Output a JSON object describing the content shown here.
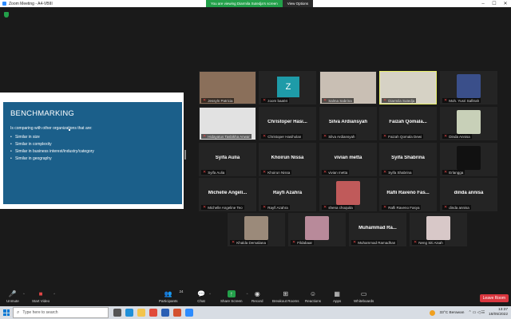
{
  "titlebar": {
    "title": "Zoom Meeting - A4-VBIII"
  },
  "banner": {
    "viewing": "You are viewing Diarmila Sutedja's screen",
    "options": "View Options"
  },
  "slide": {
    "title": "BENCHMARKING",
    "intro": "Is comparing with other organizations that are:",
    "bullets": [
      "Similar in size",
      "Similar in complexity",
      "Similar in business interest/industry/category",
      "Similar in geography"
    ]
  },
  "tiles": [
    {
      "label": "Jessyln Patricia",
      "bigname": "",
      "kind": "video",
      "color": "#8a6f5a"
    },
    {
      "label": "zoom baa04",
      "bigname": "",
      "kind": "z"
    },
    {
      "label": "Salma Sabrina",
      "bigname": "",
      "kind": "video",
      "color": "#c9bfb4"
    },
    {
      "label": "Diarmila Sutedja",
      "bigname": "",
      "kind": "video",
      "color": "#d6d2c5",
      "active": true
    },
    {
      "label": "Moh. Yusri Safitrah",
      "bigname": "",
      "kind": "photo",
      "color": "#3a4f8a"
    },
    {
      "label": "Hidayatus Tasbikha Anwar",
      "bigname": "",
      "kind": "video",
      "color": "#e2e2e2"
    },
    {
      "label": "Christoper Hasiholan",
      "bigname": "Christoper   Hasi...",
      "kind": "name"
    },
    {
      "label": "Silva Ardiansyah",
      "bigname": "Silva Ardiansyah",
      "kind": "name"
    },
    {
      "label": "Faizah Qomala Dewi",
      "bigname": "Faizah   Qomala...",
      "kind": "name"
    },
    {
      "label": "Dinda Annisa",
      "bigname": "",
      "kind": "photo",
      "color": "#c8d0b8"
    },
    {
      "label": "Syifa Aulia",
      "bigname": "Syifa Aulia",
      "kind": "name"
    },
    {
      "label": "Khoirun Nissa",
      "bigname": "Khoirun Nissa",
      "kind": "name"
    },
    {
      "label": "vivian metta",
      "bigname": "vivian metta",
      "kind": "name"
    },
    {
      "label": "Syifa Shabrina",
      "bigname": "Syifa Shabrina",
      "kind": "name"
    },
    {
      "label": "Erlangga",
      "bigname": "",
      "kind": "photo",
      "color": "#111111"
    },
    {
      "label": "Michelle Angeline Teo",
      "bigname": "Michelle   Angeli...",
      "kind": "name"
    },
    {
      "label": "Rayfi Azahra",
      "bigname": "Rayfi Azahra",
      "kind": "name"
    },
    {
      "label": "shena choquita",
      "bigname": "",
      "kind": "photo",
      "color": "#c05a5a"
    },
    {
      "label": "Rafli Raveno Fasya",
      "bigname": "Rafli  Raveno  Fas...",
      "kind": "name"
    },
    {
      "label": "dinda annisa",
      "bigname": "dinda annisa",
      "kind": "name"
    },
    {
      "label": "Khalda Demaliana",
      "bigname": "",
      "kind": "photo",
      "color": "#9b8a7a"
    },
    {
      "label": "Fildabaar",
      "bigname": "",
      "kind": "photo",
      "color": "#b88a9a"
    },
    {
      "label": "Muhammad Ramadhan",
      "bigname": "Muhammad   Ra...",
      "kind": "name"
    },
    {
      "label": "Neng Siti Aisah",
      "bigname": "",
      "kind": "photo",
      "color": "#d8c8c8"
    }
  ],
  "toolbar": {
    "unmute": "Unmute",
    "start_video": "Start Video",
    "participants": "Participants",
    "participants_count": "24",
    "chat": "Chat",
    "share_screen": "Share Screen",
    "record": "Record",
    "breakout": "Breakout Rooms",
    "reactions": "Reactions",
    "apps": "Apps",
    "whiteboards": "Whiteboards",
    "leave": "Leave Room"
  },
  "taskbar": {
    "search_placeholder": "Type here to search",
    "weather": "33°C  Berawan",
    "time": "13:37",
    "date": "18/05/2022"
  }
}
